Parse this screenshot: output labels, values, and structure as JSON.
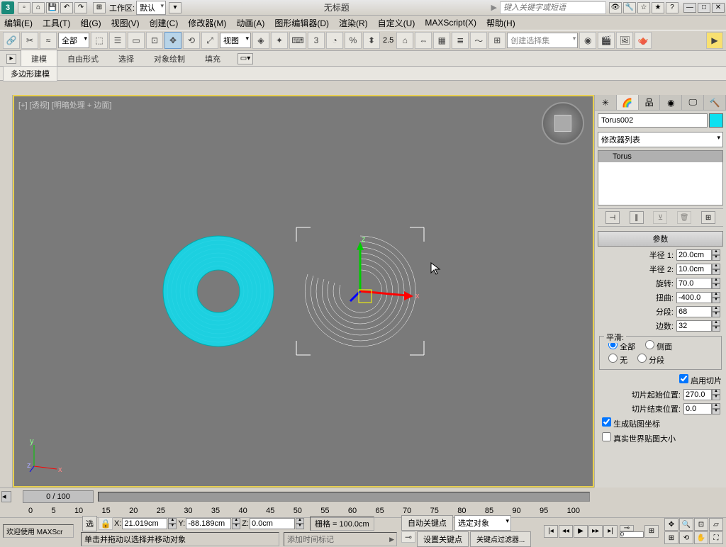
{
  "title": "无标题",
  "search_placeholder": "键入关键字或短语",
  "workspace": {
    "label": "工作区:",
    "value": "默认"
  },
  "menubar": [
    "编辑(E)",
    "工具(T)",
    "组(G)",
    "视图(V)",
    "创建(C)",
    "修改器(M)",
    "动画(A)",
    "图形编辑器(D)",
    "渲染(R)",
    "自定义(U)",
    "MAXScript(X)",
    "帮助(H)"
  ],
  "toolbar": {
    "scope_sel": "全部",
    "view_sel": "视图",
    "deg_label": "2.5",
    "selset_placeholder": "创建选择集"
  },
  "ribbon": {
    "tabs": [
      "建模",
      "自由形式",
      "选择",
      "对象绘制",
      "填充"
    ],
    "subtab": "多边形建模"
  },
  "viewport": {
    "label": "[+] [透视] [明暗处理 + 边面]"
  },
  "panel": {
    "object_name": "Torus002",
    "modlist_label": "修改器列表",
    "stack_item": "Torus",
    "rollout_title": "参数",
    "params": {
      "radius1_label": "半径 1:",
      "radius1": "20.0cm",
      "radius2_label": "半径 2:",
      "radius2": "10.0cm",
      "rotation_label": "旋转:",
      "rotation": "70.0",
      "twist_label": "扭曲:",
      "twist": "-400.0",
      "segments_label": "分段:",
      "segments": "68",
      "sides_label": "边数:",
      "sides": "32"
    },
    "smooth": {
      "title": "平滑:",
      "all": "全部",
      "sides": "侧面",
      "none": "无",
      "segs": "分段"
    },
    "slice": {
      "enable": "启用切片",
      "from_label": "切片起始位置:",
      "from": "270.0",
      "to_label": "切片结束位置:",
      "to": "0.0"
    },
    "mapcoords": "生成贴图坐标",
    "realworld": "真实世界贴图大小"
  },
  "timeline": {
    "slider": "0 / 100",
    "ticks": [
      "0",
      "5",
      "10",
      "15",
      "20",
      "25",
      "30",
      "35",
      "40",
      "45",
      "50",
      "55",
      "60",
      "65",
      "70",
      "75",
      "80",
      "85",
      "90",
      "95",
      "100"
    ]
  },
  "status": {
    "welcome": "欢迎使用 MAXScr",
    "hint": "单击并拖动以选择并移动对象",
    "sel_label": "选",
    "x": "21.019cm",
    "y": "-88.189cm",
    "z": "0.0cm",
    "grid": "栅格 = 100.0cm",
    "addmarker": "添加时间标记",
    "autokey": "自动关键点",
    "setkey": "设置关键点",
    "selobj": "选定对象",
    "keyfilter": "关键点过滤器..."
  }
}
